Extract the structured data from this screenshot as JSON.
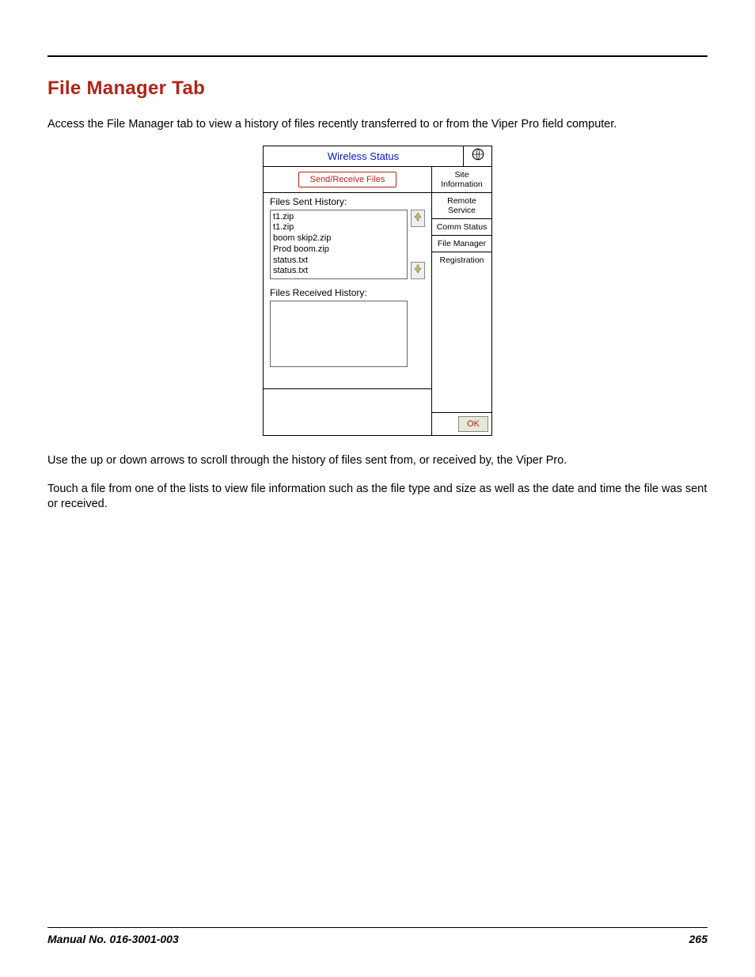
{
  "heading": "File Manager Tab",
  "intro": "Access the File Manager tab to view a history of files recently transferred to or from the Viper Pro field computer.",
  "para2": "Use the up or down arrows to scroll through the history of files sent from, or received by, the Viper Pro.",
  "para3": "Touch a file from one of the lists to view file information such as the file type and size as well as the date and time the file was sent or received.",
  "footer": {
    "left": "Manual No. 016-3001-003",
    "right": "265"
  },
  "app": {
    "title": "Wireless Status",
    "send_button": "Send/Receive Files",
    "sent_label": "Files Sent History:",
    "received_label": "Files Received History:",
    "ok": "OK",
    "sent_files": [
      "t1.zip",
      "t1.zip",
      "boom skip2.zip",
      "Prod boom.zip",
      "status.txt",
      "status.txt"
    ],
    "received_files": [],
    "tabs": [
      "Site Information",
      "Remote Service",
      "Comm Status",
      "File Manager",
      "Registration"
    ]
  }
}
